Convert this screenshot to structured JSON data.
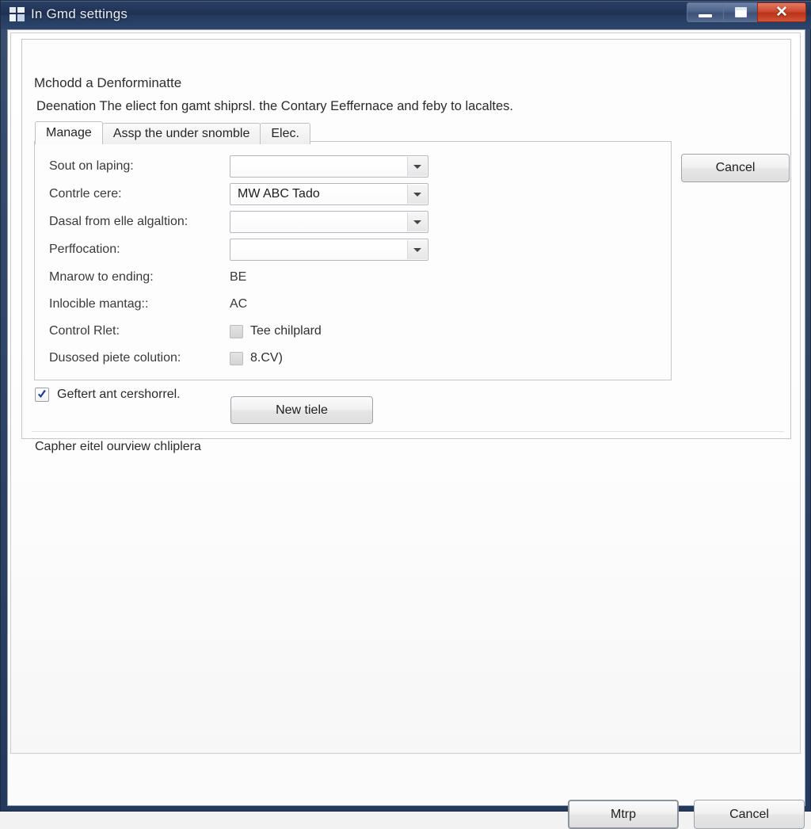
{
  "window": {
    "title": "In Gmd settings",
    "icon": "window-grid-icon",
    "controls": {
      "minimize": "minimize-icon",
      "maximize": "maximize-icon",
      "close": "close-icon"
    },
    "accent_titlebar": "#24395c",
    "accent_close": "#c9462b"
  },
  "group": {
    "legend": "Mchodd a Denforminatte",
    "description": "Deenation The eliect fon gamt shiprsl. the Contary Eeffernace and feby to lacaltes."
  },
  "tabs": [
    {
      "label": "Manage",
      "active": true
    },
    {
      "label": "Assp the under snomble",
      "active": false
    },
    {
      "label": "Elec.",
      "active": false
    }
  ],
  "form": {
    "rows": [
      {
        "label": "Sout on laping:",
        "type": "combo",
        "value": ""
      },
      {
        "label": "Contrle cere:",
        "type": "combo",
        "value": "MW ABC Tado"
      },
      {
        "label": "Dasal from elle algaltion:",
        "type": "combo",
        "value": ""
      },
      {
        "label": "Perffocation:",
        "type": "combo",
        "value": ""
      },
      {
        "label": "Mnarow to ending:",
        "type": "text",
        "value": "BE"
      },
      {
        "label": "Inlocible mantag::",
        "type": "text",
        "value": "AC"
      },
      {
        "label": "Control Rlet:",
        "type": "checkbox",
        "value": "Tee chilplard",
        "checked": false
      },
      {
        "label": "Dusosed piete colution:",
        "type": "checkbox",
        "value": "8.CV)",
        "checked": false
      }
    ]
  },
  "options": {
    "checkbox_label": "Geftert ant cershorrel.",
    "checkbox_checked": true,
    "new_tiele_button": "New tiele",
    "cancel_button": "Cancel",
    "footer_text": "Capher eitel ourview chliplera"
  },
  "footer_buttons": {
    "primary": "Mtrp",
    "secondary": "Cancel"
  }
}
